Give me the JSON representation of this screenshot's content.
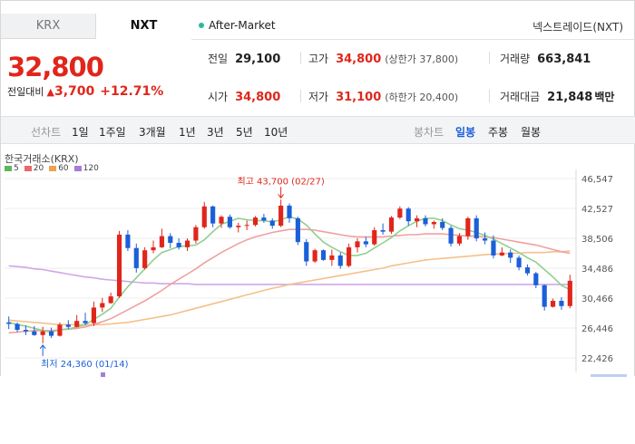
{
  "tabs": [
    {
      "label": "KRX",
      "active": false
    },
    {
      "label": "NXT",
      "active": true
    }
  ],
  "after_market": "After-Market",
  "nxt_link": "넥스트레이드(NXT)",
  "price": "32,800",
  "change": {
    "label": "전일대비",
    "arrow": "▲",
    "value": "3,700",
    "percent": "+12.71%"
  },
  "stats": {
    "prev_close": {
      "label": "전일",
      "value": "29,100"
    },
    "high": {
      "label": "고가",
      "value": "34,800",
      "sub": "(상한가 37,800)"
    },
    "volume": {
      "label": "거래량",
      "value": "663,841"
    },
    "open": {
      "label": "시가",
      "value": "34,800"
    },
    "low": {
      "label": "저가",
      "value": "31,100",
      "sub": "(하한가 20,400)"
    },
    "amount": {
      "label": "거래대금",
      "value": "21,848",
      "unit": "백만"
    }
  },
  "period_bar": {
    "line_label": "선차트",
    "line_periods": [
      "1일",
      "1주일",
      "3개월",
      "1년",
      "3년",
      "5년",
      "10년"
    ],
    "candle_label": "봉차트",
    "candle_periods": [
      "일봉",
      "주봉",
      "월봉"
    ],
    "candle_selected": "일봉"
  },
  "chart_title": "한국거래소(KRX)",
  "legend": [
    {
      "label": "5",
      "color": "#5cb85c"
    },
    {
      "label": "20",
      "color": "#e8686a"
    },
    {
      "label": "60",
      "color": "#f0a050"
    },
    {
      "label": "120",
      "color": "#a77bd8"
    }
  ],
  "colors": {
    "up": "#e0261b",
    "down": "#1b5fd9",
    "ma5": "#8fd08f",
    "ma20": "#f0a0a0",
    "ma60": "#f5c08a",
    "ma120": "#cfa8e8"
  },
  "chart_data": {
    "type": "candlestick",
    "y_ticks": [
      "46,547",
      "42,527",
      "38,506",
      "34,486",
      "30,466",
      "26,446",
      "22,426"
    ],
    "ylim": [
      22426,
      46547
    ],
    "max_annotation": "최고 43,700 (02/27)",
    "min_annotation": "최저 24,360 (01/14)",
    "candles": [
      [
        27200,
        28000,
        26300,
        27000
      ],
      [
        27000,
        27200,
        25900,
        26200
      ],
      [
        26200,
        26800,
        25500,
        26000
      ],
      [
        26000,
        26700,
        25400,
        25500
      ],
      [
        25500,
        26600,
        24400,
        26000
      ],
      [
        26000,
        26500,
        25100,
        25400
      ],
      [
        25400,
        27200,
        25300,
        26900
      ],
      [
        26900,
        27500,
        26300,
        26600
      ],
      [
        26600,
        28200,
        26500,
        27400
      ],
      [
        27400,
        28500,
        26800,
        27100
      ],
      [
        27100,
        30000,
        26700,
        29200
      ],
      [
        29200,
        30500,
        28600,
        29800
      ],
      [
        29800,
        31200,
        29700,
        30700
      ],
      [
        30700,
        39500,
        30500,
        39000
      ],
      [
        39000,
        39600,
        36800,
        37200
      ],
      [
        37200,
        37800,
        33900,
        34500
      ],
      [
        34500,
        37300,
        34300,
        36900
      ],
      [
        36900,
        38200,
        36500,
        37300
      ],
      [
        37300,
        39800,
        37200,
        38800
      ],
      [
        38800,
        39200,
        37200,
        37900
      ],
      [
        37900,
        38500,
        37000,
        37300
      ],
      [
        37300,
        38500,
        36800,
        38200
      ],
      [
        38200,
        40300,
        37800,
        40000
      ],
      [
        40000,
        43400,
        39800,
        42800
      ],
      [
        42800,
        42900,
        40000,
        40500
      ],
      [
        40500,
        41600,
        39900,
        41400
      ],
      [
        41400,
        41700,
        39800,
        40000
      ],
      [
        40000,
        40600,
        39300,
        40200
      ],
      [
        40200,
        40900,
        39600,
        40300
      ],
      [
        40300,
        41500,
        40100,
        41300
      ],
      [
        41300,
        41800,
        40600,
        40900
      ],
      [
        40900,
        41200,
        39800,
        40200
      ],
      [
        40200,
        43700,
        40000,
        42900
      ],
      [
        42900,
        43200,
        40600,
        41200
      ],
      [
        41200,
        41400,
        37600,
        38000
      ],
      [
        38000,
        38400,
        34800,
        35400
      ],
      [
        35400,
        37100,
        35200,
        36900
      ],
      [
        36900,
        37000,
        35500,
        35600
      ],
      [
        35600,
        37000,
        34800,
        36200
      ],
      [
        36200,
        36600,
        34400,
        34800
      ],
      [
        34800,
        37800,
        34600,
        37300
      ],
      [
        37300,
        38500,
        36600,
        38100
      ],
      [
        38100,
        38700,
        37300,
        37700
      ],
      [
        37700,
        40000,
        37500,
        39600
      ],
      [
        39600,
        40500,
        39000,
        39400
      ],
      [
        39400,
        41500,
        39100,
        41300
      ],
      [
        41300,
        42800,
        41100,
        42500
      ],
      [
        42500,
        42700,
        40200,
        40800
      ],
      [
        40800,
        41600,
        40000,
        41200
      ],
      [
        41200,
        41600,
        40100,
        40400
      ],
      [
        40400,
        40900,
        39800,
        40700
      ],
      [
        40700,
        41200,
        39600,
        39900
      ],
      [
        39900,
        40200,
        37400,
        37800
      ],
      [
        37800,
        39200,
        37500,
        38800
      ],
      [
        38800,
        41400,
        38300,
        41200
      ],
      [
        41200,
        41600,
        38100,
        38500
      ],
      [
        38500,
        39300,
        37700,
        38200
      ],
      [
        38200,
        38900,
        35800,
        36200
      ],
      [
        36200,
        37300,
        36100,
        36600
      ],
      [
        36600,
        37000,
        35200,
        35900
      ],
      [
        35900,
        36200,
        34200,
        34600
      ],
      [
        34600,
        35000,
        33500,
        33800
      ],
      [
        33800,
        34000,
        31800,
        32200
      ],
      [
        32200,
        32300,
        28800,
        29300
      ],
      [
        29300,
        30400,
        29200,
        30100
      ],
      [
        30100,
        30600,
        28900,
        29400
      ],
      [
        29400,
        33600,
        29100,
        32800
      ]
    ],
    "ma5": [
      27200,
      26900,
      26700,
      26400,
      26100,
      25900,
      26200,
      26300,
      26600,
      26900,
      27600,
      28300,
      29100,
      30600,
      32000,
      33200,
      34400,
      35600,
      36600,
      37000,
      37400,
      37500,
      37600,
      38300,
      39400,
      40400,
      40800,
      41200,
      41000,
      40900,
      40900,
      40700,
      41000,
      41400,
      41100,
      40300,
      39100,
      38000,
      37300,
      36700,
      36200,
      36200,
      36500,
      37200,
      37900,
      38600,
      39500,
      40200,
      40800,
      41200,
      41200,
      40900,
      40300,
      39800,
      39600,
      39300,
      38900,
      38400,
      37800,
      37200,
      36600,
      35900,
      35300,
      34300,
      33300,
      32200,
      31600
    ],
    "ma20": [
      25800,
      25900,
      26000,
      26100,
      26100,
      26100,
      26200,
      26300,
      26400,
      26600,
      26900,
      27300,
      27700,
      28300,
      28900,
      29500,
      30100,
      30800,
      31500,
      32300,
      33000,
      33700,
      34400,
      35200,
      35900,
      36600,
      37200,
      37800,
      38300,
      38700,
      39000,
      39300,
      39500,
      39700,
      39700,
      39700,
      39600,
      39400,
      39200,
      39000,
      38800,
      38700,
      38700,
      38700,
      38700,
      38800,
      38900,
      39000,
      39000,
      39100,
      39100,
      39100,
      39000,
      38900,
      38800,
      38800,
      38700,
      38600,
      38400,
      38200,
      38000,
      37800,
      37600,
      37300,
      37000,
      36700,
      36500
    ],
    "ma60": [
      27500,
      27400,
      27300,
      27200,
      27100,
      27000,
      26900,
      26900,
      26900,
      26900,
      26900,
      26900,
      27000,
      27100,
      27200,
      27400,
      27600,
      27800,
      28000,
      28200,
      28500,
      28800,
      29100,
      29400,
      29700,
      30000,
      30300,
      30600,
      30900,
      31200,
      31500,
      31800,
      32000,
      32300,
      32500,
      32700,
      32900,
      33100,
      33300,
      33500,
      33700,
      33900,
      34100,
      34300,
      34500,
      34800,
      35000,
      35200,
      35400,
      35600,
      35700,
      35800,
      35900,
      36000,
      36100,
      36200,
      36300,
      36400,
      36400,
      36500,
      36500,
      36600,
      36600,
      36600,
      36700,
      36700,
      36800
    ],
    "ma120": [
      34800,
      34700,
      34600,
      34400,
      34300,
      34100,
      33900,
      33700,
      33500,
      33300,
      33200,
      33000,
      32900,
      32800,
      32700,
      32600,
      32500,
      32500,
      32400,
      32400,
      32400,
      32400,
      32300,
      32300,
      32300,
      32300,
      32300,
      32300,
      32300,
      32300,
      32300,
      32300,
      32300,
      32300,
      32300,
      32300,
      32300,
      32300,
      32300,
      32300,
      32300,
      32300,
      32300,
      32300,
      32300,
      32300,
      32300,
      32300,
      32300,
      32300,
      32300,
      32300,
      32300,
      32300,
      32300,
      32300,
      32300,
      32300,
      32300,
      32300,
      32300,
      32300,
      32300,
      32300,
      32300,
      32300,
      32300
    ]
  }
}
